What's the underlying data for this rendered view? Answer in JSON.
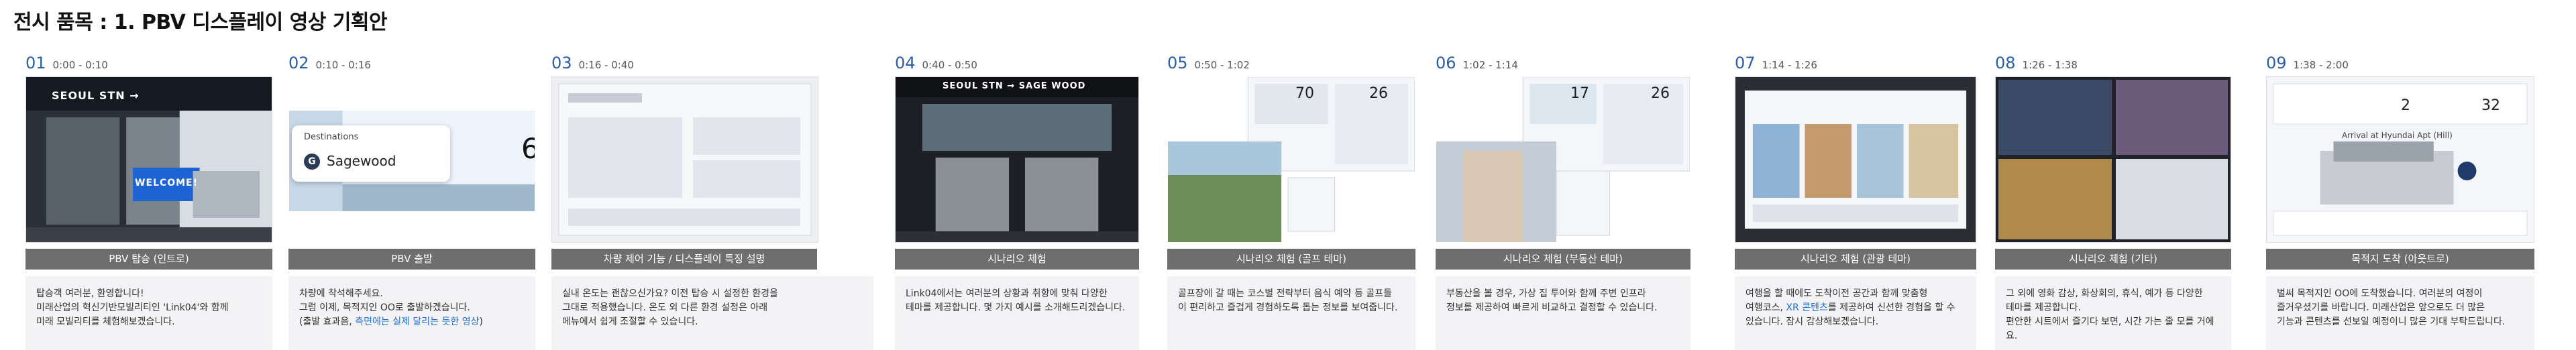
{
  "page": {
    "title": "전시 품목 : 1. PBV 디스플레이 영상 기획안",
    "accent_color": "#2a5ea8",
    "label_bar_color": "#6e6e6e",
    "link_color": "#1f6fd6"
  },
  "scenes": [
    {
      "number": "01",
      "time": "0:00 - 0:10",
      "label": "PBV 탑승 (인트로)",
      "description": "탑승객 여러분, 환영합니다!\n미래산업의 혁신기반모빌리티인 'Link04'와 함께\n미래 모빌리티를 체험해보겠습니다.",
      "screen_sign": "SEOUL STN →",
      "screen_welcome": "WELCOME!",
      "icon": "bus-interior-icon"
    },
    {
      "number": "02",
      "time": "0:10 - 0:16",
      "label": "PBV 출발",
      "description": "차량에 착석해주세요.\n그럼 이제, 목적지인 OO로 출발하겠습니다.",
      "note_prefix": "(출발 효과음, ",
      "note_link": "측면에는 실제 달리는 듯한 영상",
      "note_suffix": ")",
      "destination_label": "Destinations",
      "destination_badge": "G",
      "destination_value": "Sagewood",
      "destination_cut": "6",
      "icon": "destination-card-icon"
    },
    {
      "number": "03",
      "time": "0:16 - 0:40",
      "label": "차량 제어 기능 / 디스플레이 특징 설명",
      "description": "실내 온도는 괜찮으신가요? 이전 탑승 시 설정한 환경을\n그대로 적용했습니다. 온도 외 다른 환경 설정은 아래\n메뉴에서 쉽게 조절할 수 있습니다.",
      "icon": "climate-control-icon"
    },
    {
      "number": "04",
      "time": "0:40 - 0:50",
      "label": "시나리오 체험",
      "description": "Link04에서는 여러분의 상황과 취향에 맞춰 다양한\n테마를 제공합니다. 몇 가지 예시를 소개해드리겠습니다.",
      "screen_sign": "SEOUL STN → SAGE WOOD",
      "icon": "cabin-seats-icon"
    },
    {
      "number": "05",
      "time": "0:50 - 1:02",
      "label": "시나리오 체험 (골프 테마)",
      "description": "골프장에 갈 때는 코스별 전략부터 음식 예약 등 골프들\n이 편리하고 즐겁게 경험하도록 돕는 정보를 보여줍니다.",
      "panel_number": "70",
      "panel_number_2": "26",
      "icon": "golf-course-icon"
    },
    {
      "number": "06",
      "time": "1:02 - 1:14",
      "label": "시나리오 체험 (부동산 테마)",
      "description": "부동산을 볼 경우, 가상 집 투어와 함께 주변 인프라\n정보를 제공하여 빠르게 비교하고 결정할 수 있습니다.",
      "panel_number": "17",
      "panel_number_2": "26",
      "icon": "apartment-building-icon"
    },
    {
      "number": "07",
      "time": "1:14 - 1:26",
      "label": "시나리오 체험 (관광 테마)",
      "description_prefix": "여행을 할 때에도 도착이전 공간과 함께 맞춤형\n여행코스, ",
      "description_link": "XR 콘텐츠",
      "description_suffix": "를 제공하여 신선한 경험을 할 수\n있습니다. 잠시 감상해보겠습니다.",
      "icon": "travel-gallery-icon"
    },
    {
      "number": "08",
      "time": "1:26 - 1:38",
      "label": "시나리오 체험 (기타)",
      "description": "그 외에 영화 감상, 화상회의, 휴식, 예가 등 다양한\n테마를 제공합니다.\n편안한 시트에서 즐기다 보면, 시간 가는 줄 모를 거에요.",
      "icon": "entertainment-grid-icon"
    },
    {
      "number": "09",
      "time": "1:38 - 2:00",
      "label": "목적지 도착 (아웃트로)",
      "description": "벌써 목적지인 OO에 도착했습니다. 여러분의 여정이\n즐거우셨기를 바랍니다. 미래산업은 앞으로도 더 많은\n기능과 콘텐츠를 선보일 예정이니 많은 기대 부탁드립니다.",
      "arrival_text": "Arrival at Hyundai Apt (Hill)",
      "panel_number": "2",
      "panel_number_2": "32",
      "icon": "arrival-van-icon"
    }
  ]
}
